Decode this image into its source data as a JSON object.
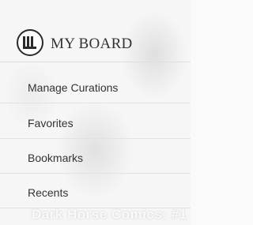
{
  "background": {
    "caption": "Dark Horse Comics: #1"
  },
  "header": {
    "title": "MY BOARD"
  },
  "menu": {
    "items": [
      {
        "label": "Manage Curations"
      },
      {
        "label": "Favorites"
      },
      {
        "label": "Bookmarks"
      },
      {
        "label": "Recents"
      }
    ]
  }
}
